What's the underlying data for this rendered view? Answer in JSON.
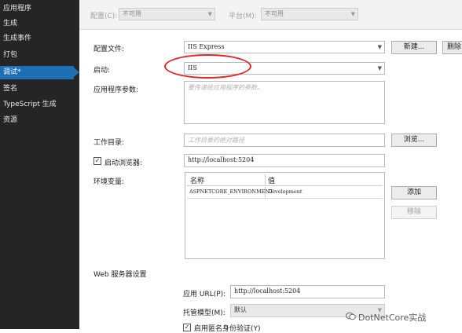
{
  "sidebar": {
    "items": [
      {
        "label": "应用程序",
        "active": false
      },
      {
        "label": "生成",
        "active": false
      },
      {
        "label": "生成事件",
        "active": false
      },
      {
        "label": "打包",
        "active": false
      },
      {
        "label": "调试*",
        "active": true
      },
      {
        "label": "签名",
        "active": false
      },
      {
        "label": "TypeScript 生成",
        "active": false
      },
      {
        "label": "资源",
        "active": false
      }
    ]
  },
  "topbar": {
    "config_label": "配置(C):",
    "config_value": "不可用",
    "platform_label": "平台(M):",
    "platform_value": "不可用"
  },
  "form": {
    "profile_label": "配置文件:",
    "profile_value": "IIS Express",
    "new_button": "新建...",
    "delete_button": "删除",
    "launch_label": "启动:",
    "launch_value": "IIS",
    "args_label": "应用程序参数:",
    "args_placeholder": "要传递给应用程序的参数。",
    "workdir_label": "工作目录:",
    "workdir_placeholder": "工作目录的绝对路径",
    "browse_button": "浏览...",
    "launch_browser_label": "启动浏览器:",
    "launch_browser_checked": "✓",
    "launch_browser_url": "http://localhost:5204",
    "env_label": "环境变量:",
    "env_columns": [
      "名称",
      "值"
    ],
    "env_rows": [
      {
        "name": "ASPNETCORE_ENVIRONMENT",
        "value": "Development"
      }
    ],
    "add_button": "添加",
    "remove_button": "移除",
    "web_server_section": "Web 服务器设置",
    "app_url_label": "应用 URL(P):",
    "app_url_value": "http://localhost:5204",
    "hosting_model_label": "托管模型(M):",
    "hosting_model_value": "默认",
    "anon_auth_checked": "✓",
    "anon_auth_label": "启用匿名身份验证(Y)"
  },
  "watermark": "DotNetCore实战",
  "colors": {
    "sidebar_bg": "#252526",
    "sidebar_active": "#1f6fb4",
    "annotation": "#e0242c"
  }
}
